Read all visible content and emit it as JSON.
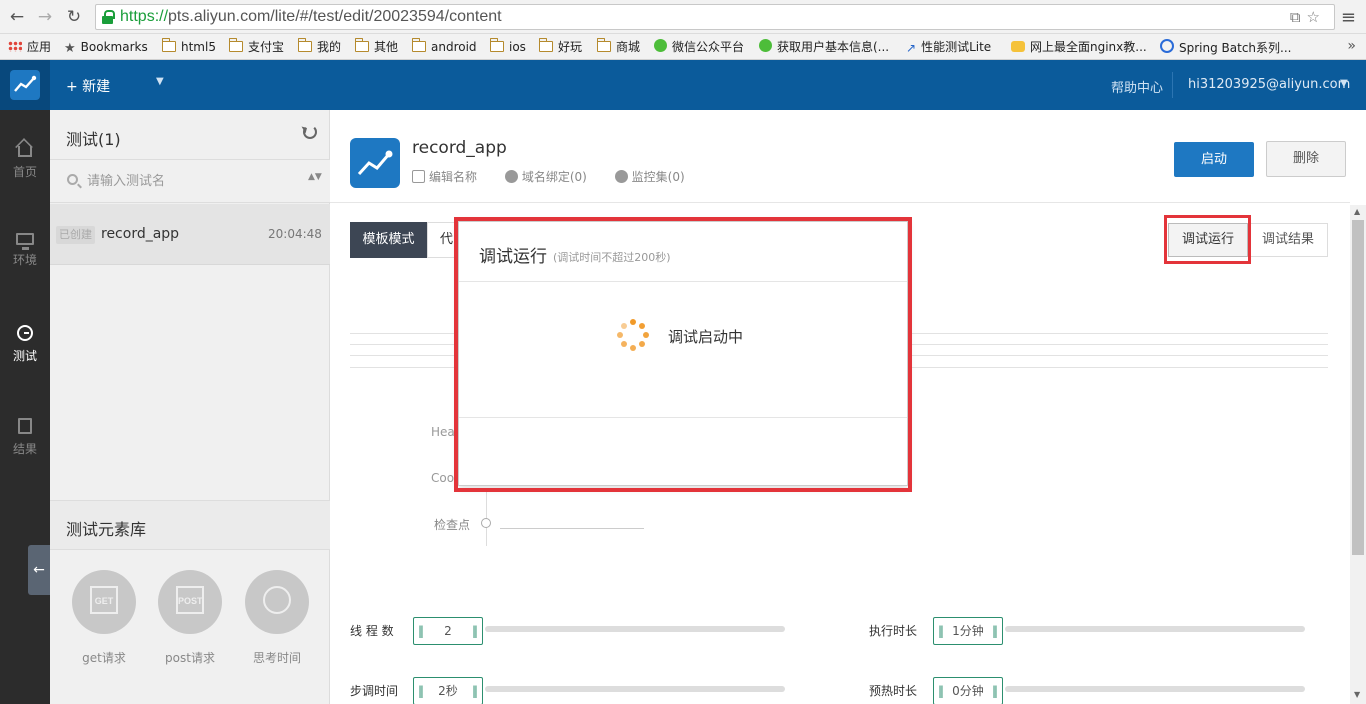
{
  "browser": {
    "url_scheme": "https://",
    "url_rest": "pts.aliyun.com/lite/#/test/edit/20023594/content",
    "back_glyph": "←",
    "forward_glyph": "→",
    "reload_glyph": "↻",
    "url_icons": "⧉☆",
    "menu_glyph": "≡",
    "bookmarks": [
      {
        "label": "应用",
        "icon": "apps-icon"
      },
      {
        "label": "Bookmarks",
        "icon": "star-icon"
      },
      {
        "label": "html5",
        "icon": "folder-icon"
      },
      {
        "label": "支付宝",
        "icon": "folder-icon"
      },
      {
        "label": "我的",
        "icon": "folder-icon"
      },
      {
        "label": "其他",
        "icon": "folder-icon"
      },
      {
        "label": "android",
        "icon": "folder-icon"
      },
      {
        "label": "ios",
        "icon": "folder-icon"
      },
      {
        "label": "好玩",
        "icon": "folder-icon"
      },
      {
        "label": "商城",
        "icon": "folder-icon"
      },
      {
        "label": "微信公众平台",
        "icon": "wechat-icon"
      },
      {
        "label": "获取用户基本信息(...",
        "icon": "wechat-icon"
      },
      {
        "label": "性能测试Lite",
        "icon": "chart-icon"
      },
      {
        "label": "网上最全面nginx教...",
        "icon": "bubble-icon"
      },
      {
        "label": "Spring Batch系列...",
        "icon": "spring-icon"
      }
    ],
    "bookmarks_more": "»"
  },
  "header": {
    "new_label": "+  新建",
    "new_caret": "▼",
    "help_label": "帮助中心",
    "user_label": "hi31203925@aliyun.com",
    "user_caret": "▼"
  },
  "rail": {
    "items": [
      {
        "label": "首页",
        "icon": "home-icon"
      },
      {
        "label": "环境",
        "icon": "monitor-icon"
      },
      {
        "label": "测试",
        "icon": "gauge-icon",
        "active": true
      },
      {
        "label": "结果",
        "icon": "document-icon"
      }
    ]
  },
  "test_list": {
    "title": "测试(1)",
    "search_placeholder": "请输入测试名",
    "sort_glyph": "▲▼",
    "rows": [
      {
        "status": "已创建",
        "name": "record_app",
        "time": "20:04:48"
      }
    ]
  },
  "library": {
    "title": "测试元素库",
    "items": [
      {
        "label": "get请求",
        "icon_text": "GET"
      },
      {
        "label": "post请求",
        "icon_text": "POST"
      },
      {
        "label": "思考时间",
        "icon_text": ""
      }
    ],
    "collapse_glyph": "←"
  },
  "project": {
    "name": "record_app",
    "edit_name": "编辑名称",
    "domain_binding": "域名绑定(0)",
    "monitor_set": "监控集(0)",
    "start_label": "启动",
    "delete_label": "删除"
  },
  "editor": {
    "mode_tab": "模板模式",
    "code_tab": "代",
    "debug_run": "调试运行",
    "debug_result": "调试结果",
    "header_label": "Hea",
    "cookie_label": "Coo",
    "checkpoint_label": "检查点"
  },
  "settings": {
    "threads_label": "线 程 数",
    "threads_value": "2",
    "duration_label": "执行时长",
    "duration_value": "1分钟",
    "step_label": "步调时间",
    "step_value": "2秒",
    "warmup_label": "预热时长",
    "warmup_value": "0分钟"
  },
  "scrollbar": {
    "up": "▲",
    "down": "▼"
  },
  "modal": {
    "title": "调试运行",
    "subtitle": "(调试时间不超过200秒)",
    "message": "调试启动中"
  },
  "colors": {
    "brand": "#0b5b9b",
    "highlight": "#e3343a",
    "spinner": "#f19a29"
  }
}
